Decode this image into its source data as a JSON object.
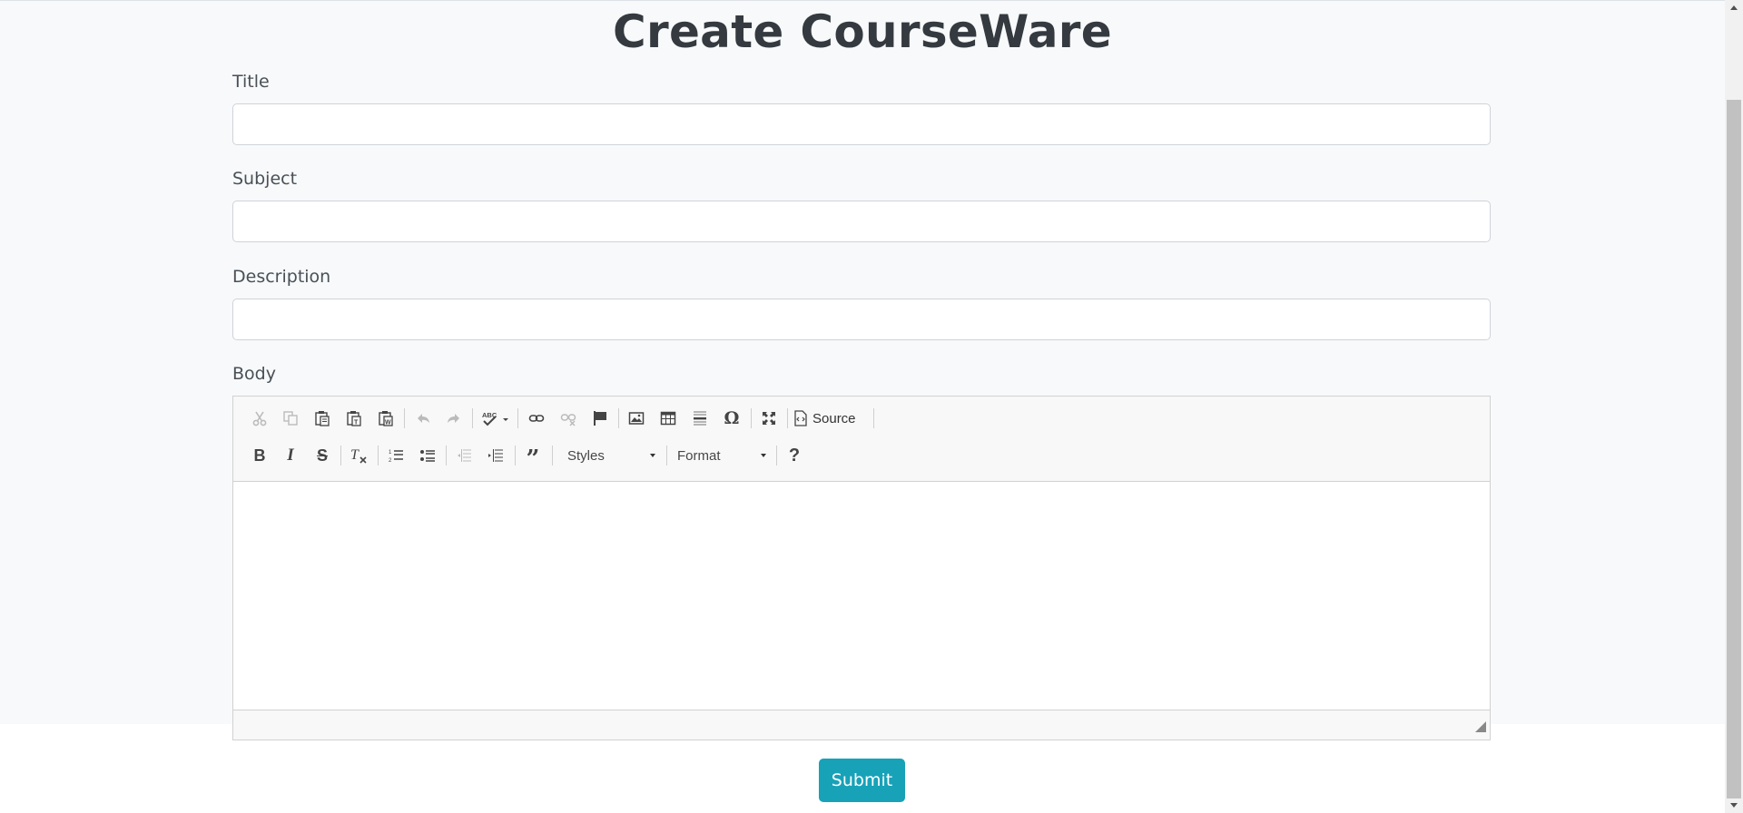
{
  "page": {
    "title": "Create CourseWare"
  },
  "form": {
    "title_label": "Title",
    "title_value": "",
    "subject_label": "Subject",
    "subject_value": "",
    "description_label": "Description",
    "description_value": "",
    "body_label": "Body",
    "submit_label": "Submit"
  },
  "editor": {
    "source_label": "Source",
    "styles_label": "Styles",
    "format_label": "Format",
    "content": "",
    "toolbar_row1": [
      "cut-icon",
      "copy-icon",
      "paste-icon",
      "paste-text-icon",
      "paste-word-icon",
      "undo-icon",
      "redo-icon",
      "spellcheck-icon",
      "link-icon",
      "unlink-icon",
      "anchor-icon",
      "image-icon",
      "table-icon",
      "horizontal-line-icon",
      "special-char-icon",
      "maximize-icon",
      "source-icon"
    ],
    "toolbar_row2": [
      "bold-icon",
      "italic-icon",
      "strikethrough-icon",
      "remove-format-icon",
      "numbered-list-icon",
      "bulleted-list-icon",
      "outdent-icon",
      "indent-icon",
      "blockquote-icon",
      "help-icon"
    ]
  },
  "colors": {
    "accent": "#17a2b8",
    "title": "#343a40",
    "background": "#f8f9fa"
  }
}
